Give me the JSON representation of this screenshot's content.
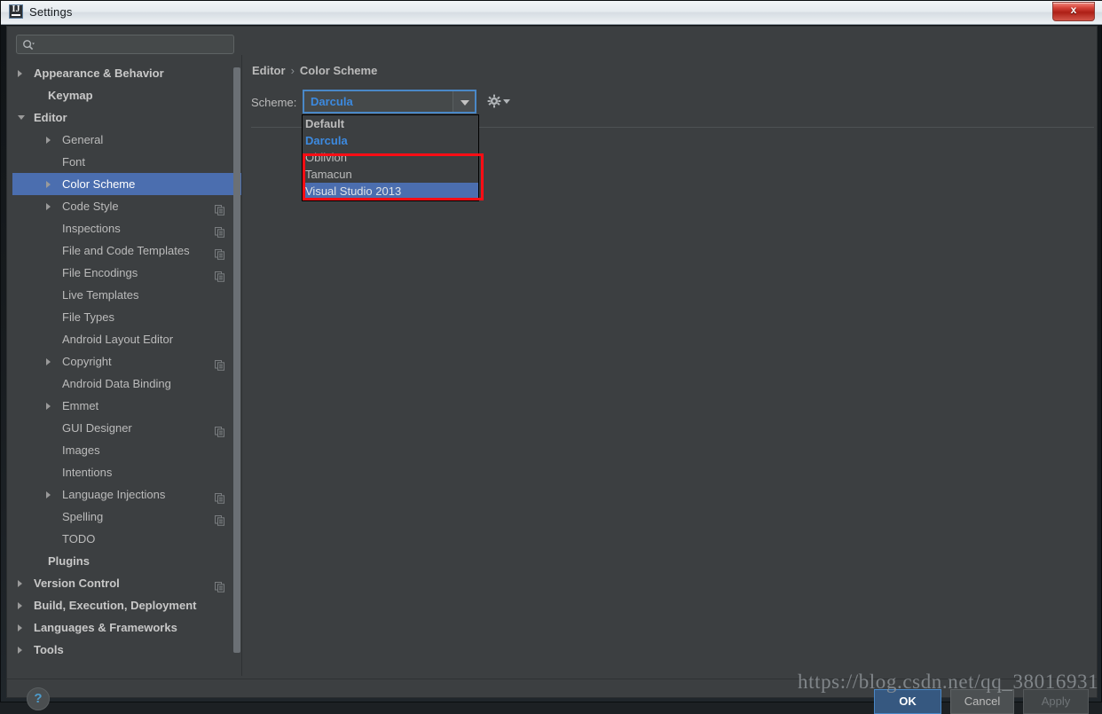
{
  "window": {
    "title": "Settings",
    "app_icon": "intellij-idea-icon",
    "close_label": "x"
  },
  "search": {
    "value": "",
    "placeholder": "",
    "icon": "search-icon"
  },
  "sidebar": {
    "scrollbar": "vertical-scrollbar",
    "items": [
      {
        "label": "Appearance & Behavior",
        "indent": 24,
        "twisty": "right",
        "bold": true,
        "selected": false,
        "scope_icon": false
      },
      {
        "label": "Keymap",
        "indent": 40,
        "twisty": "none",
        "bold": true,
        "selected": false,
        "scope_icon": false
      },
      {
        "label": "Editor",
        "indent": 24,
        "twisty": "down",
        "bold": true,
        "selected": false,
        "scope_icon": false
      },
      {
        "label": "General",
        "indent": 56,
        "twisty": "right",
        "bold": false,
        "selected": false,
        "scope_icon": false
      },
      {
        "label": "Font",
        "indent": 56,
        "twisty": "none",
        "bold": false,
        "selected": false,
        "scope_icon": false
      },
      {
        "label": "Color Scheme",
        "indent": 56,
        "twisty": "right",
        "bold": false,
        "selected": true,
        "scope_icon": false
      },
      {
        "label": "Code Style",
        "indent": 56,
        "twisty": "right",
        "bold": false,
        "selected": false,
        "scope_icon": true
      },
      {
        "label": "Inspections",
        "indent": 56,
        "twisty": "none",
        "bold": false,
        "selected": false,
        "scope_icon": true
      },
      {
        "label": "File and Code Templates",
        "indent": 56,
        "twisty": "none",
        "bold": false,
        "selected": false,
        "scope_icon": true
      },
      {
        "label": "File Encodings",
        "indent": 56,
        "twisty": "none",
        "bold": false,
        "selected": false,
        "scope_icon": true
      },
      {
        "label": "Live Templates",
        "indent": 56,
        "twisty": "none",
        "bold": false,
        "selected": false,
        "scope_icon": false
      },
      {
        "label": "File Types",
        "indent": 56,
        "twisty": "none",
        "bold": false,
        "selected": false,
        "scope_icon": false
      },
      {
        "label": "Android Layout Editor",
        "indent": 56,
        "twisty": "none",
        "bold": false,
        "selected": false,
        "scope_icon": false
      },
      {
        "label": "Copyright",
        "indent": 56,
        "twisty": "right",
        "bold": false,
        "selected": false,
        "scope_icon": true
      },
      {
        "label": "Android Data Binding",
        "indent": 56,
        "twisty": "none",
        "bold": false,
        "selected": false,
        "scope_icon": false
      },
      {
        "label": "Emmet",
        "indent": 56,
        "twisty": "right",
        "bold": false,
        "selected": false,
        "scope_icon": false
      },
      {
        "label": "GUI Designer",
        "indent": 56,
        "twisty": "none",
        "bold": false,
        "selected": false,
        "scope_icon": true
      },
      {
        "label": "Images",
        "indent": 56,
        "twisty": "none",
        "bold": false,
        "selected": false,
        "scope_icon": false
      },
      {
        "label": "Intentions",
        "indent": 56,
        "twisty": "none",
        "bold": false,
        "selected": false,
        "scope_icon": false
      },
      {
        "label": "Language Injections",
        "indent": 56,
        "twisty": "right",
        "bold": false,
        "selected": false,
        "scope_icon": true
      },
      {
        "label": "Spelling",
        "indent": 56,
        "twisty": "none",
        "bold": false,
        "selected": false,
        "scope_icon": true
      },
      {
        "label": "TODO",
        "indent": 56,
        "twisty": "none",
        "bold": false,
        "selected": false,
        "scope_icon": false
      },
      {
        "label": "Plugins",
        "indent": 40,
        "twisty": "none",
        "bold": true,
        "selected": false,
        "scope_icon": false
      },
      {
        "label": "Version Control",
        "indent": 24,
        "twisty": "right",
        "bold": true,
        "selected": false,
        "scope_icon": true
      },
      {
        "label": "Build, Execution, Deployment",
        "indent": 24,
        "twisty": "right",
        "bold": true,
        "selected": false,
        "scope_icon": false
      },
      {
        "label": "Languages & Frameworks",
        "indent": 24,
        "twisty": "right",
        "bold": true,
        "selected": false,
        "scope_icon": false
      },
      {
        "label": "Tools",
        "indent": 24,
        "twisty": "right",
        "bold": true,
        "selected": false,
        "scope_icon": false
      }
    ]
  },
  "content": {
    "breadcrumb": {
      "parent": "Editor",
      "separator": "›",
      "current": "Color Scheme"
    },
    "scheme_field": {
      "label": "Scheme:",
      "value": "Darcula",
      "arrow_icon": "chevron-down-icon",
      "settings_icon": "gear-icon"
    },
    "dropdown": {
      "options": [
        {
          "label": "Default",
          "style": "bold",
          "selected": false
        },
        {
          "label": "Darcula",
          "style": "accent",
          "selected": false
        },
        {
          "label": "Oblivion",
          "style": "normal",
          "selected": false
        },
        {
          "label": "Tamacun",
          "style": "normal",
          "selected": false
        },
        {
          "label": "Visual Studio 2013",
          "style": "normal",
          "selected": true
        }
      ]
    },
    "annotation": {
      "type": "red-rectangle",
      "color": "#ff0d14"
    }
  },
  "footer": {
    "help_label": "?",
    "ok_label": "OK",
    "cancel_label": "Cancel",
    "apply_label": "Apply",
    "apply_disabled": true
  },
  "watermark": {
    "text": "https://blog.csdn.net/qq_38016931"
  },
  "colors": {
    "accent_blue": "#4b6eaf",
    "link_blue": "#3c8ae0",
    "focus_border": "#4a88c7",
    "panel_bg": "#3c3f41",
    "field_bg": "#45494a",
    "text": "#bbbbbb",
    "annotation_red": "#ff0d14"
  }
}
